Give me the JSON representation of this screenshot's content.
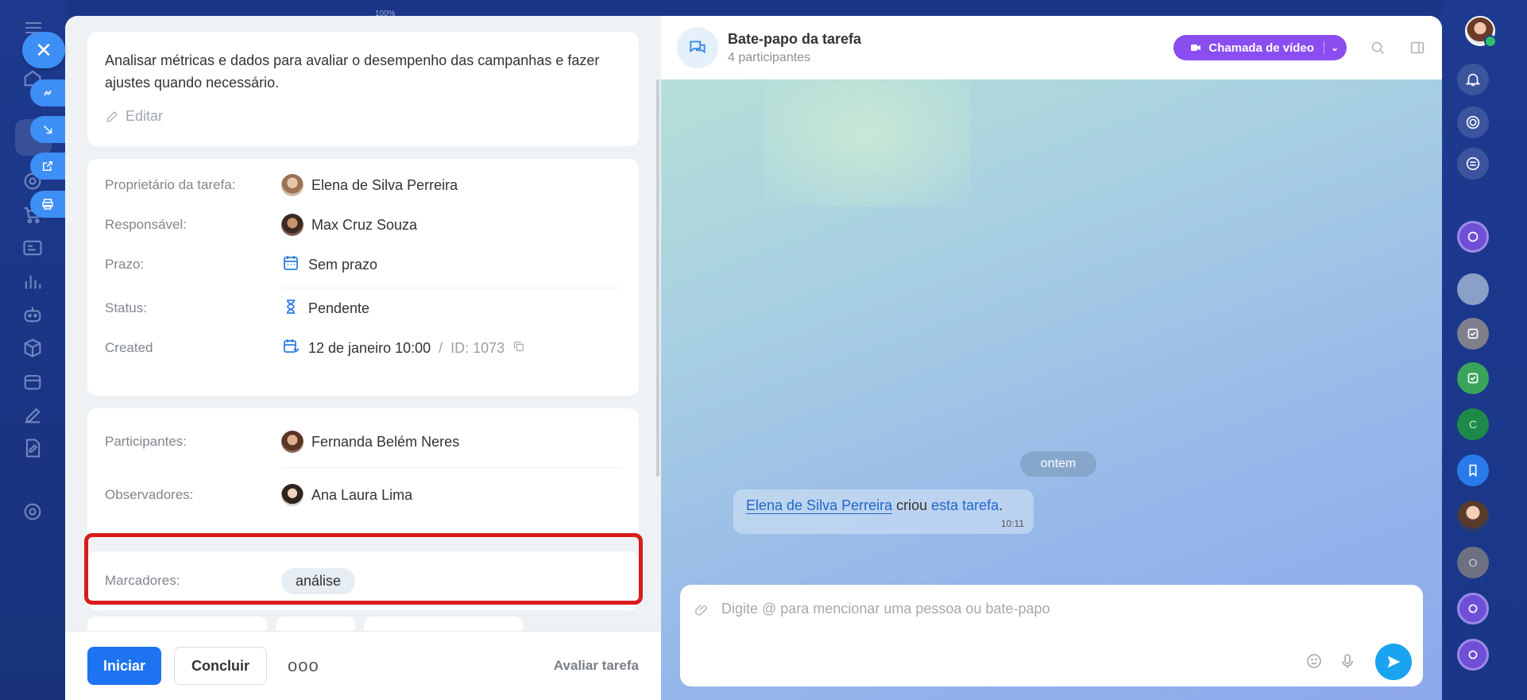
{
  "background": {
    "zoom_label": "100%"
  },
  "task": {
    "description": "Analisar métricas e dados para avaliar o desempenho das campanhas e fazer ajustes quando necessário.",
    "edit_label": "Editar",
    "fields": {
      "owner_label": "Proprietário da tarefa:",
      "owner_value": "Elena de Silva Perreira",
      "responsible_label": "Responsável:",
      "responsible_value": "Max Cruz Souza",
      "deadline_label": "Prazo:",
      "deadline_value": "Sem prazo",
      "status_label": "Status:",
      "status_value": "Pendente",
      "created_label": "Created",
      "created_value": "12 de janeiro 10:00",
      "created_sep": "/",
      "created_id": "ID: 1073",
      "participants_label": "Participantes:",
      "participants_value": "Fernanda Belém Neres",
      "observers_label": "Observadores:",
      "observers_value": "Ana Laura Lima",
      "tags_label": "Marcadores:",
      "tag_value": "análise"
    },
    "footer": {
      "start_label": "Iniciar",
      "complete_label": "Concluir",
      "more_label": "ooo",
      "rate_label": "Avaliar tarefa"
    }
  },
  "chat": {
    "title": "Bate-papo da tarefa",
    "subtitle": "4 participantes",
    "video_call_label": "Chamada de vídeo",
    "day_label": "ontem",
    "system_message": {
      "author": "Elena de Silva Perreira",
      "verb": " criou ",
      "link": "esta tarefa",
      "end": ".",
      "time": "10:11"
    },
    "composer_placeholder": "Digite @ para mencionar uma pessoa ou bate-papo"
  },
  "colors": {
    "primary": "#1e73f0",
    "video": "#8a4df0",
    "highlight": "#d81c1c",
    "send": "#1aa4f0"
  }
}
